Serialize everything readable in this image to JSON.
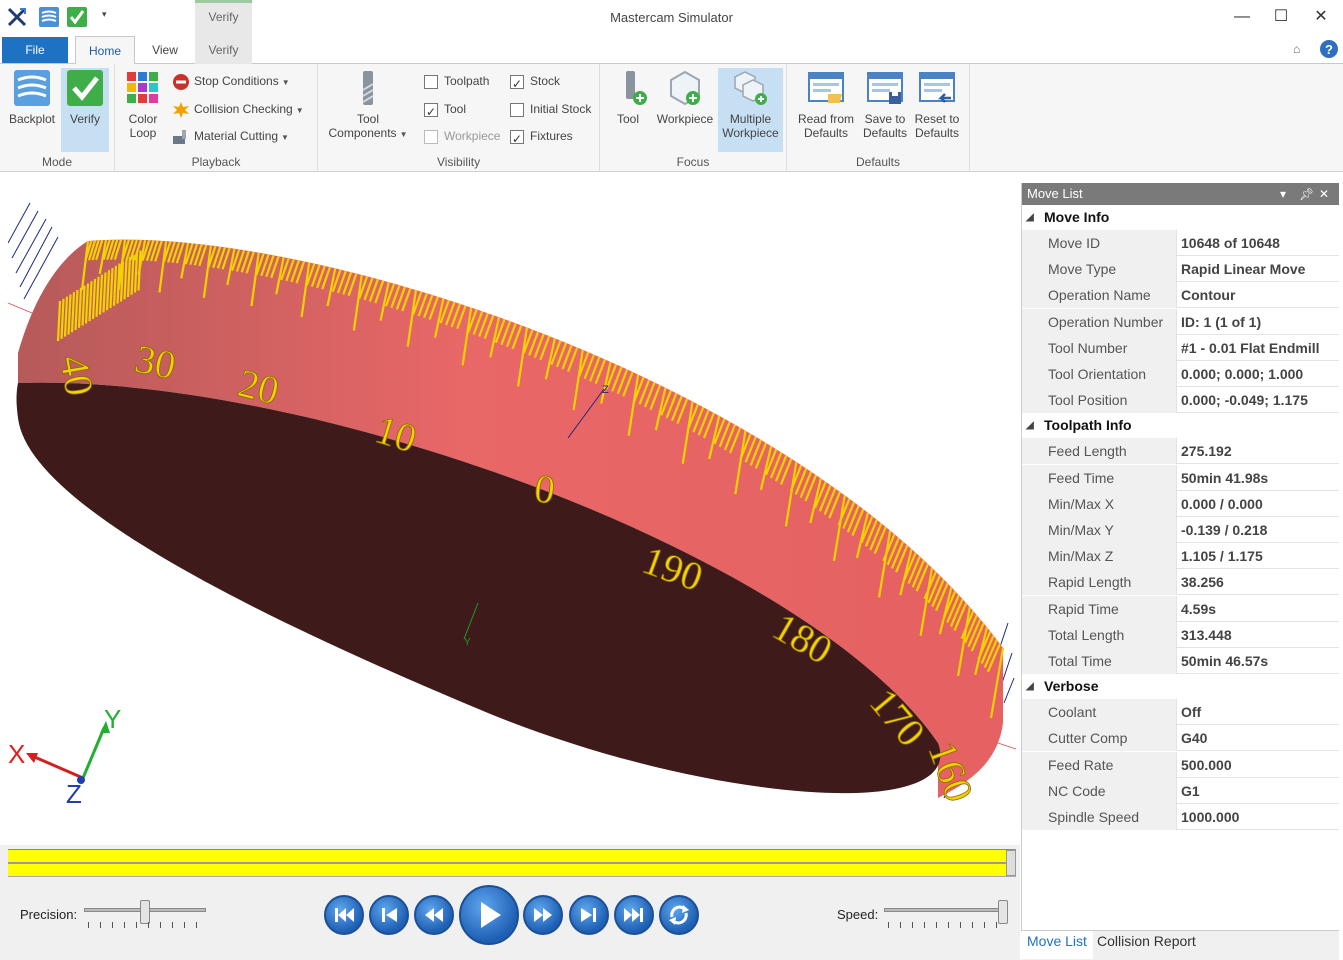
{
  "window": {
    "title": "Mastercam Simulator",
    "context_tab_title": "Verify"
  },
  "tabs": {
    "file": "File",
    "home": "Home",
    "view": "View",
    "verify": "Verify"
  },
  "ribbon": {
    "mode": {
      "label": "Mode",
      "backplot": "Backplot",
      "verify": "Verify"
    },
    "playback": {
      "label": "Playback",
      "color_loop_line1": "Color",
      "color_loop_line2": "Loop",
      "stop_conditions": "Stop Conditions",
      "collision_checking": "Collision Checking",
      "material_cutting": "Material Cutting"
    },
    "visibility": {
      "label": "Visibility",
      "tool_components_line1": "Tool",
      "tool_components_line2": "Components",
      "toolpath": "Toolpath",
      "tool": "Tool",
      "workpiece": "Workpiece",
      "stock": "Stock",
      "initial_stock": "Initial Stock",
      "fixtures": "Fixtures"
    },
    "focus": {
      "label": "Focus",
      "tool": "Tool",
      "workpiece": "Workpiece",
      "multiple_line1": "Multiple",
      "multiple_line2": "Workpiece"
    },
    "defaults": {
      "label": "Defaults",
      "read_line1": "Read from",
      "read_line2": "Defaults",
      "save_line1": "Save to",
      "save_line2": "Defaults",
      "reset_line1": "Reset to",
      "reset_line2": "Defaults"
    }
  },
  "viewport": {
    "dial_numbers": [
      "40",
      "30",
      "20",
      "10",
      "0",
      "190",
      "180",
      "170",
      "160"
    ],
    "axis_labels": {
      "x": "X",
      "y": "Y",
      "z": "Z"
    },
    "minor_axis_labels": {
      "z": "Z",
      "y": "Y"
    },
    "colors": {
      "band": "#e86767",
      "bottom": "#3e1a1a",
      "ticks": "#f2d200"
    }
  },
  "playback_bar": {
    "precision_label": "Precision:",
    "speed_label": "Speed:",
    "progress": 1.0
  },
  "move_list": {
    "header": "Move List",
    "sections": [
      {
        "title": "Move Info",
        "rows": [
          {
            "k": "Move ID",
            "v": "10648 of 10648"
          },
          {
            "k": "Move Type",
            "v": "Rapid Linear Move"
          },
          {
            "k": "Operation Name",
            "v": "Contour"
          },
          {
            "k": "Operation Number",
            "v": "ID: 1 (1 of 1)"
          },
          {
            "k": "Tool Number",
            "v": "#1 - 0.01 Flat Endmill"
          },
          {
            "k": "Tool Orientation",
            "v": "0.000; 0.000; 1.000"
          },
          {
            "k": "Tool Position",
            "v": "0.000; -0.049; 1.175"
          }
        ]
      },
      {
        "title": "Toolpath Info",
        "rows": [
          {
            "k": "Feed Length",
            "v": "275.192"
          },
          {
            "k": "Feed Time",
            "v": "50min 41.98s"
          },
          {
            "k": "Min/Max X",
            "v": "0.000 / 0.000"
          },
          {
            "k": "Min/Max Y",
            "v": "-0.139 / 0.218"
          },
          {
            "k": "Min/Max Z",
            "v": "1.105 / 1.175"
          },
          {
            "k": "Rapid Length",
            "v": "38.256"
          },
          {
            "k": "Rapid Time",
            "v": "4.59s"
          },
          {
            "k": "Total Length",
            "v": "313.448"
          },
          {
            "k": "Total Time",
            "v": "50min 46.57s"
          }
        ]
      },
      {
        "title": "Verbose",
        "rows": [
          {
            "k": "Coolant",
            "v": "Off"
          },
          {
            "k": "Cutter Comp",
            "v": "G40"
          },
          {
            "k": "Feed Rate",
            "v": "500.000"
          },
          {
            "k": "NC Code",
            "v": "G1"
          },
          {
            "k": "Spindle Speed",
            "v": "1000.000"
          }
        ]
      }
    ],
    "tabs": {
      "move_list": "Move List",
      "collision_report": "Collision Report"
    }
  }
}
